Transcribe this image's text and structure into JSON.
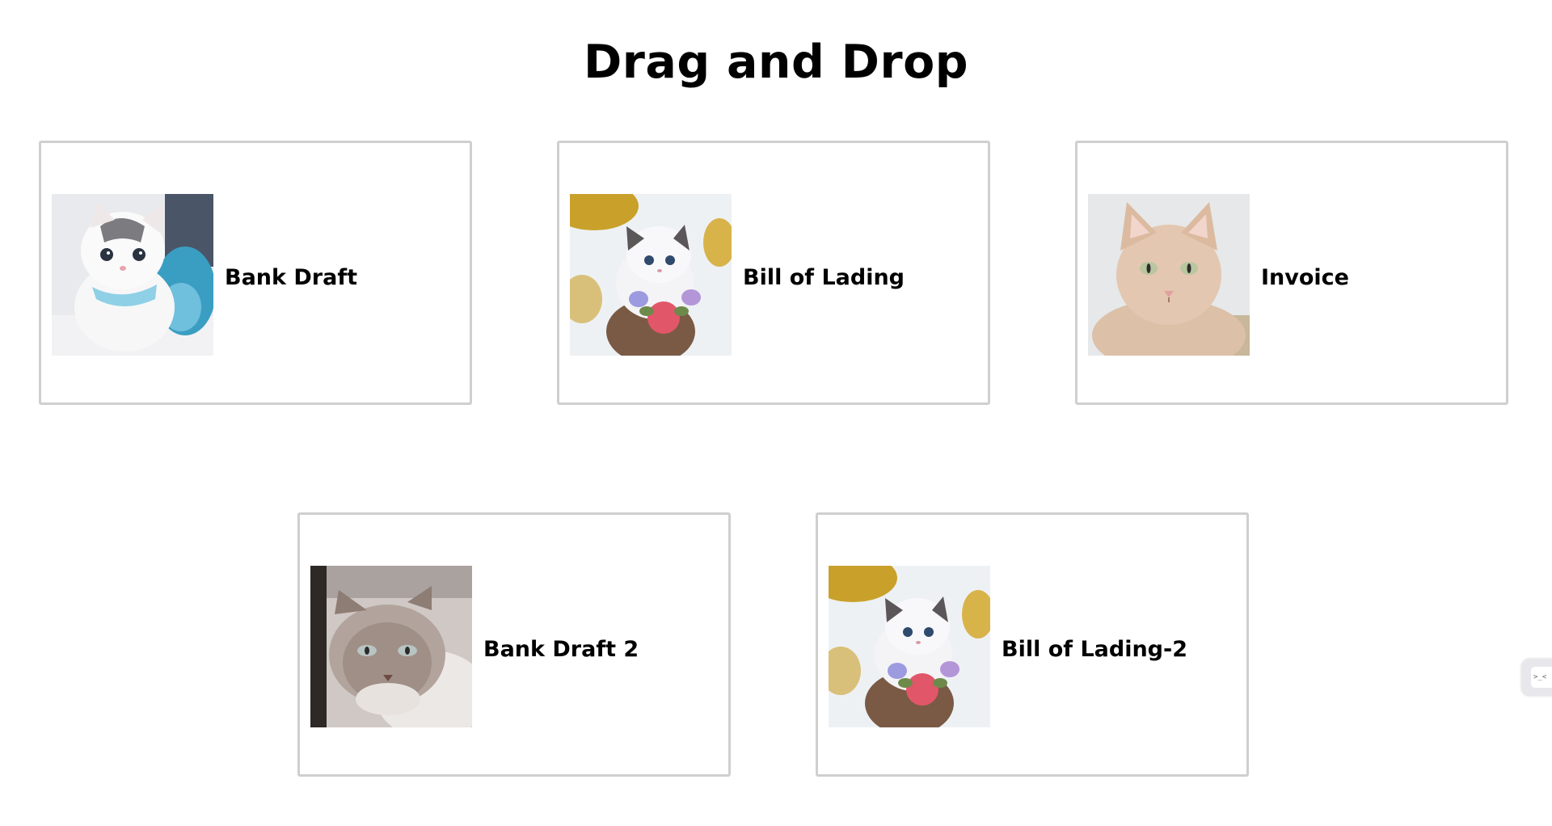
{
  "page": {
    "title": "Drag and Drop"
  },
  "drop_zones": [
    {
      "item": {
        "label": "Bank Draft",
        "image": "white-kitten-blue-scarf"
      }
    },
    {
      "item": {
        "label": "Bill of Lading",
        "image": "kitten-flower-collar"
      }
    },
    {
      "item": {
        "label": "Invoice",
        "image": "cream-cat"
      }
    },
    {
      "item": {
        "label": "Bank Draft 2",
        "image": "grey-longhair-cat"
      }
    },
    {
      "item": {
        "label": "Bill of Lading-2",
        "image": "kitten-flower-collar"
      }
    }
  ],
  "side_widget": {
    "icon": ">_<"
  },
  "colors": {
    "box_border": "#cfcfcf",
    "background": "#ffffff",
    "text": "#000000"
  }
}
